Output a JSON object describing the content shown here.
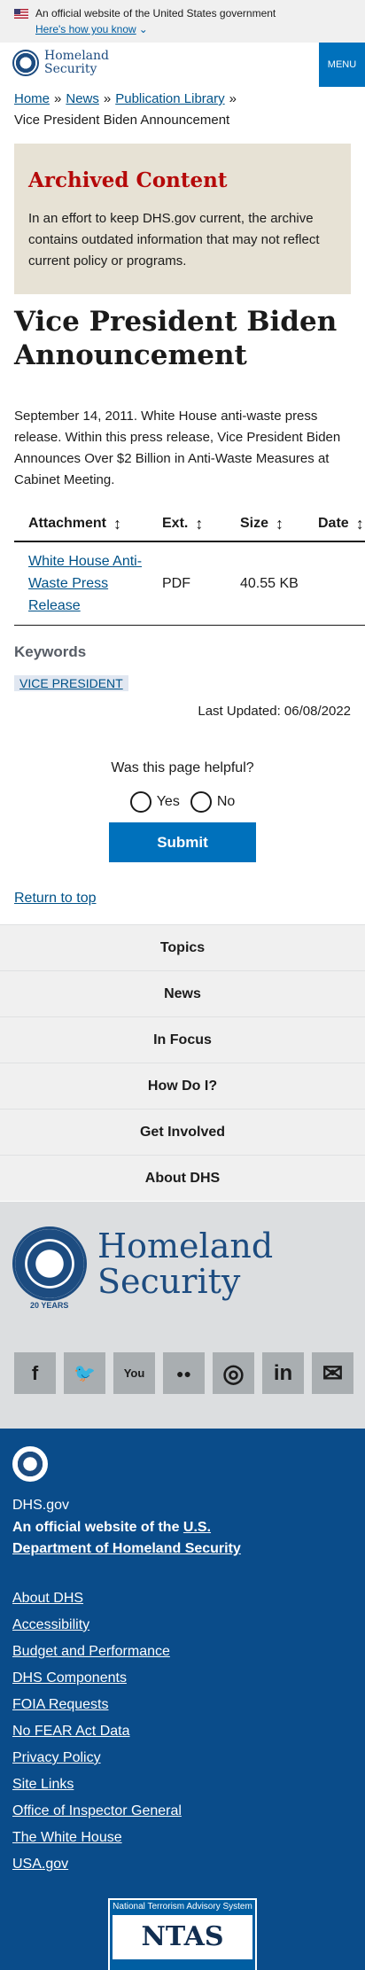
{
  "gov_banner": {
    "official_text": "An official website of the United States government",
    "how_text": "Here's how you know"
  },
  "header": {
    "logo_line1": "Homeland",
    "logo_line2": "Security",
    "menu_label": "MENU"
  },
  "breadcrumb": {
    "items": [
      "Home",
      "News",
      "Publication Library"
    ],
    "current": "Vice President Biden Announcement"
  },
  "archived": {
    "title": "Archived Content",
    "body": "In an effort to keep DHS.gov current, the archive contains outdated information that may not reflect current policy or programs."
  },
  "page": {
    "title": "Vice President Biden Announcement",
    "intro": "September 14, 2011. White House anti-waste press release. Within this press release, Vice President Biden Announces Over $2 Billion in Anti-Waste Measures at Cabinet Meeting."
  },
  "table": {
    "headers": [
      "Attachment",
      "Ext.",
      "Size",
      "Date"
    ],
    "rows": [
      {
        "attachment": "White House Anti-Waste Press Release",
        "ext": "PDF",
        "size": "40.55 KB",
        "date": ""
      }
    ]
  },
  "keywords": {
    "heading": "Keywords",
    "tags": [
      "VICE PRESIDENT"
    ]
  },
  "last_updated": "Last Updated: 06/08/2022",
  "feedback": {
    "question": "Was this page helpful?",
    "yes": "Yes",
    "no": "No",
    "submit": "Submit"
  },
  "return_to_top": "Return to top",
  "footer_nav": [
    "Topics",
    "News",
    "In Focus",
    "How Do I?",
    "Get Involved",
    "About DHS"
  ],
  "footer_logo": {
    "line1": "Homeland",
    "line2": "Security",
    "years": "20 YEARS"
  },
  "social_icons": [
    "facebook-icon",
    "twitter-icon",
    "youtube-icon",
    "flickr-icon",
    "instagram-icon",
    "linkedin-icon",
    "email-icon"
  ],
  "social_glyphs": [
    "f",
    "🐦",
    "You",
    "●●",
    "◎",
    "in",
    "✉"
  ],
  "blue_footer": {
    "site": "DHS.gov",
    "official_prefix": "An official website of the ",
    "official_link": "U.S. Department of Homeland Security",
    "links": [
      "About DHS",
      "Accessibility",
      "Budget and Performance",
      "DHS Components",
      "FOIA Requests",
      "No FEAR Act Data",
      "Privacy Policy",
      "Site Links",
      "Office of Inspector General",
      "The White House",
      "USA.gov"
    ],
    "ntas_small": "National Terrorism Advisory System",
    "ntas_big": "NTAS"
  },
  "colors": {
    "accent": "#0071bc",
    "link": "#005288",
    "archived_title": "#b50909",
    "footer_blue": "#0a4c8a"
  }
}
